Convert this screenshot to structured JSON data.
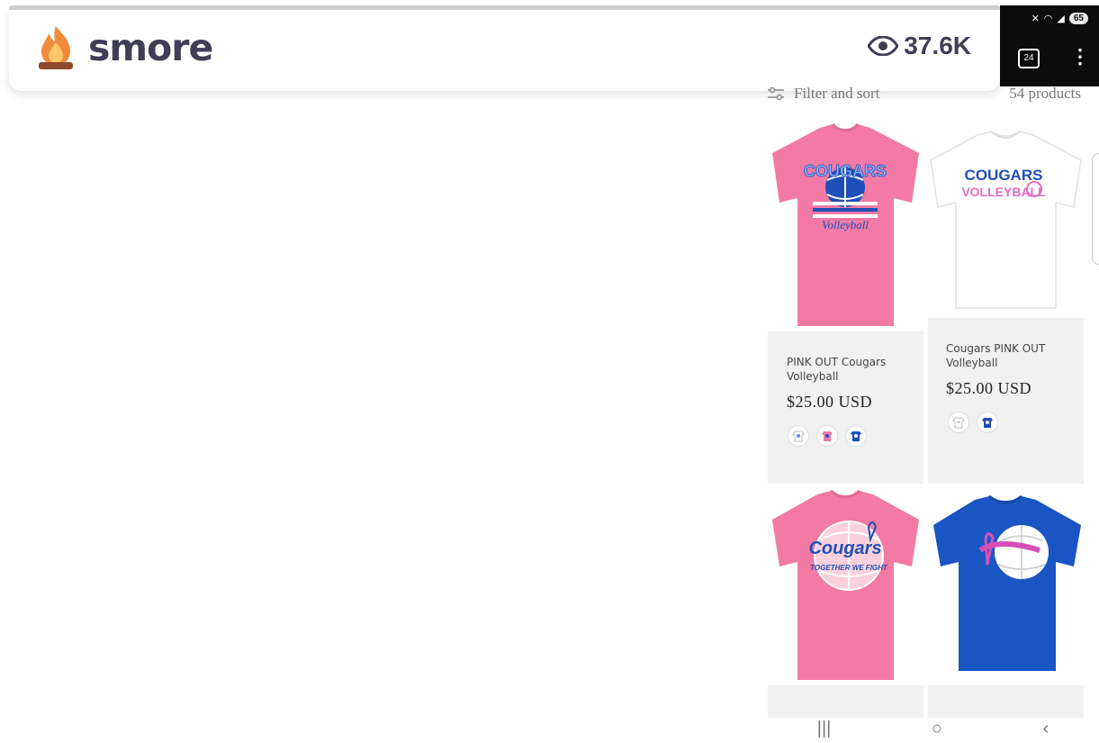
{
  "header": {
    "brand": "smore",
    "views": "37.6K"
  },
  "phone": {
    "battery": "65",
    "tab_count": "24",
    "menu": "⋮"
  },
  "store": {
    "filter_label": "Filter and sort",
    "product_count": "54 products",
    "products": [
      {
        "title_line1": "PINK OUT Cougars",
        "title_line2": "Volleyball",
        "price": "$25.00 USD",
        "shirt_color": "#f27aa5",
        "print_text": "COUGARS",
        "print_sub": "Volleyball",
        "swatches": [
          "#ffffff",
          "#f27aa5",
          "#1f4fb8"
        ]
      },
      {
        "title_line1": "Cougars PINK OUT",
        "title_line2": "Volleyball",
        "price": "$25.00 USD",
        "shirt_color": "#ffffff",
        "print_text": "COUGARS",
        "print_sub": "VOLLEYBALL",
        "swatches": [
          "#ffffff",
          "#1f4fb8"
        ]
      },
      {
        "shirt_color": "#f27aa5",
        "print_text": "Cougars",
        "print_sub": "TOGETHER WE FIGHT"
      },
      {
        "shirt_color": "#1a55c4"
      }
    ]
  },
  "navbar": {
    "recent": "|||",
    "home": "○",
    "back": "‹"
  }
}
